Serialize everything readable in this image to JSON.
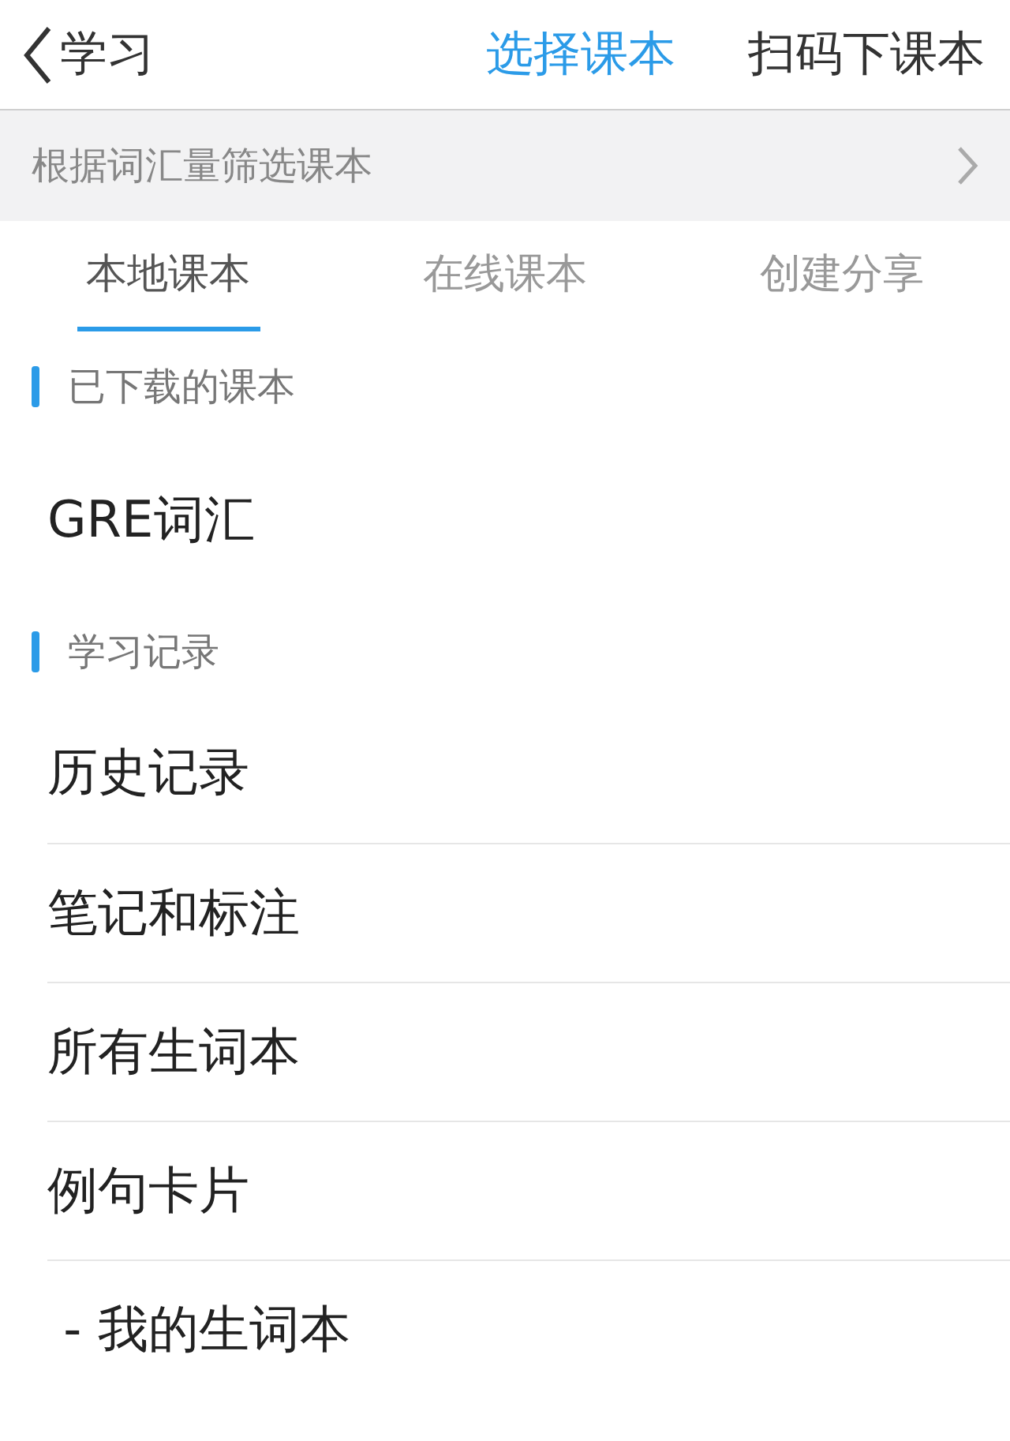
{
  "nav_bar": {
    "back_label": "学习",
    "tabs": [
      {
        "label": "选择课本",
        "selected": true
      },
      {
        "label": "扫码下课本",
        "selected": false
      }
    ]
  },
  "filter_bar": {
    "label": "根据词汇量筛选课本"
  },
  "tabs": [
    {
      "label": "本地课本",
      "selected": true
    },
    {
      "label": "在线课本",
      "selected": false
    },
    {
      "label": "创建分享",
      "selected": false
    }
  ],
  "sections": [
    {
      "title": "已下载的课本",
      "items": [
        {
          "label": "GRE词汇"
        }
      ]
    },
    {
      "title": "学习记录",
      "items": [
        {
          "label": "历史记录"
        },
        {
          "label": "笔记和标注"
        },
        {
          "label": "所有生词本"
        },
        {
          "label": "例句卡片"
        },
        {
          "label": " - 我的生词本"
        }
      ]
    }
  ]
}
